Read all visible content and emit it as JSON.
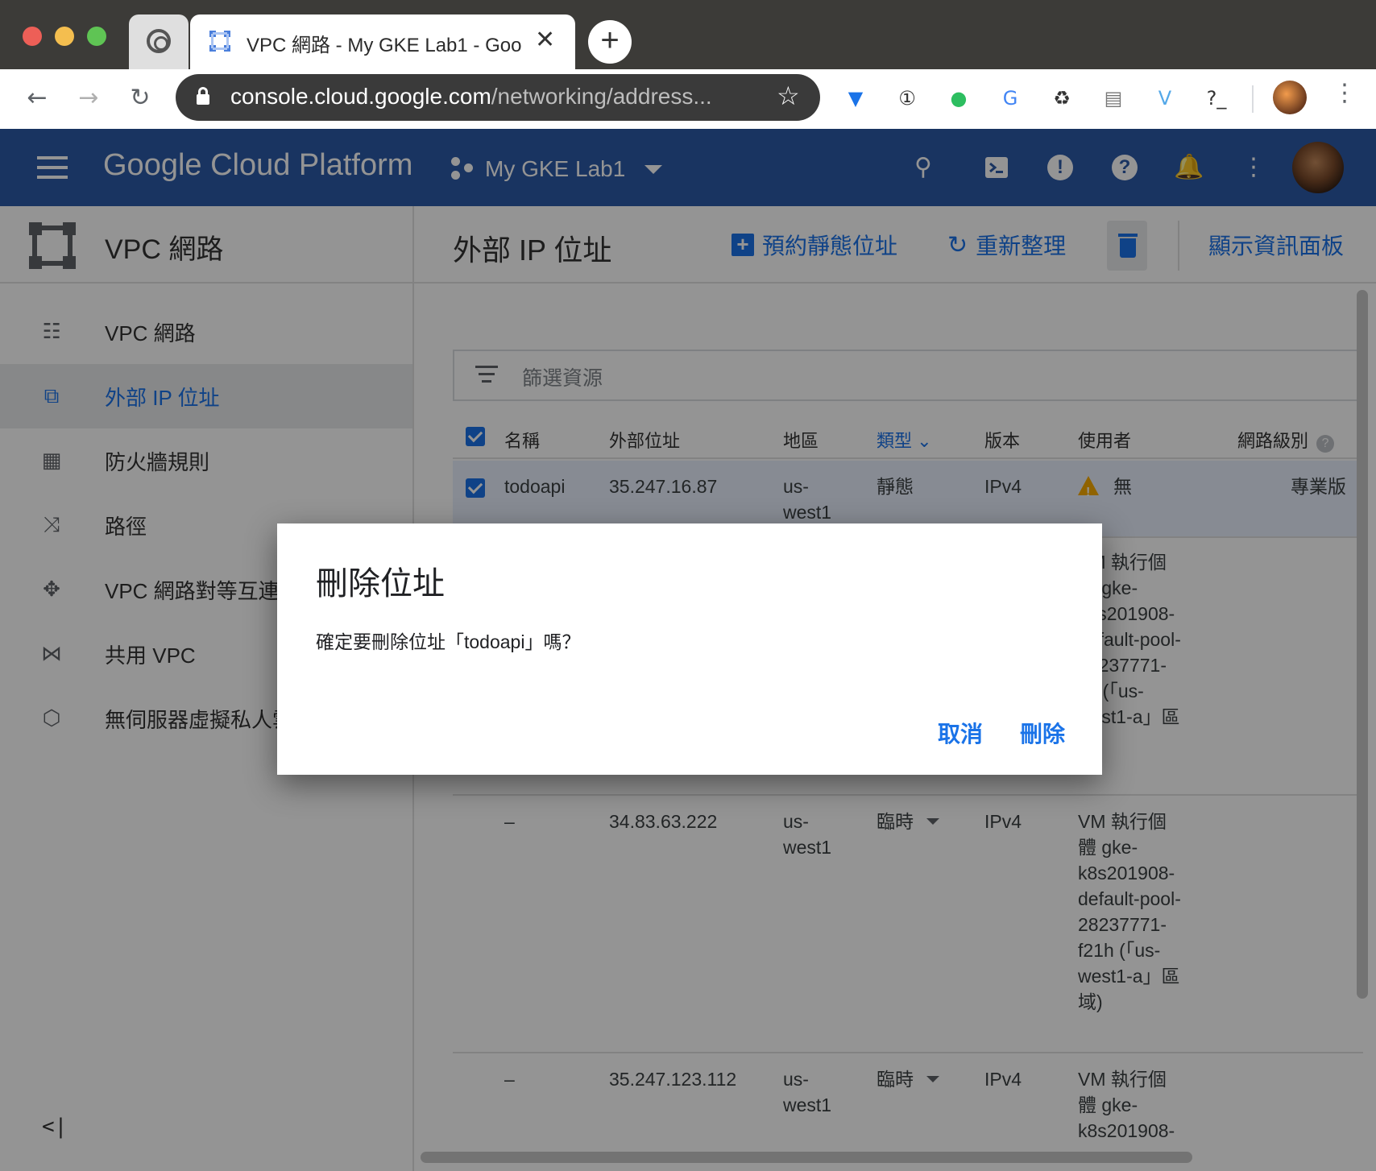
{
  "browser": {
    "tab_title": "VPC 網路 - My GKE Lab1 - Goo",
    "url_host": "console.cloud.google.com",
    "url_path": "/networking/address...",
    "new_tab": "+",
    "close": "✕",
    "extensions": [
      {
        "name": "filter-extension-icon",
        "glyph": "▼",
        "color": "#1a73e8"
      },
      {
        "name": "password-manager-icon",
        "glyph": "①",
        "color": "#333333"
      },
      {
        "name": "evernote-icon",
        "glyph": "●",
        "color": "#2dbe60"
      },
      {
        "name": "translate-icon",
        "glyph": "G",
        "color": "#4285f4"
      },
      {
        "name": "recycle-icon",
        "glyph": "♻",
        "color": "#333333"
      },
      {
        "name": "dictionary-icon",
        "glyph": "▤",
        "color": "#777777"
      },
      {
        "name": "vivaldi-icon",
        "glyph": "V",
        "color": "#54a8e8"
      },
      {
        "name": "terminal-icon",
        "glyph": "?_",
        "color": "#333333"
      }
    ]
  },
  "gcp": {
    "title": "Google Cloud Platform",
    "project": "My GKE Lab1"
  },
  "sidebar": {
    "title": "VPC 網路",
    "items": [
      {
        "label": "VPC 網路",
        "icon": "vpc-network-icon",
        "glyph": "☷",
        "active": false
      },
      {
        "label": "外部 IP 位址",
        "icon": "external-ip-icon",
        "glyph": "⧉",
        "active": true
      },
      {
        "label": "防火牆規則",
        "icon": "firewall-icon",
        "glyph": "▦",
        "active": false
      },
      {
        "label": "路徑",
        "icon": "routes-icon",
        "glyph": "⤨",
        "active": false
      },
      {
        "label": "VPC 網路對等互連",
        "icon": "peering-icon",
        "glyph": "✥",
        "active": false
      },
      {
        "label": "共用 VPC",
        "icon": "shared-vpc-icon",
        "glyph": "⋈",
        "active": false
      },
      {
        "label": "無伺服器虛擬私人雲",
        "icon": "serverless-vpc-icon",
        "glyph": "⬡",
        "active": false
      }
    ],
    "collapse": "<|"
  },
  "main": {
    "title": "外部 IP 位址",
    "actions": {
      "reserve": "預約靜態位址",
      "refresh": "重新整理",
      "show_info": "顯示資訊面板"
    },
    "filter_placeholder": "篩選資源",
    "columns": {
      "name": "名稱",
      "address": "外部位址",
      "region": "地區",
      "type": "類型",
      "version": "版本",
      "user": "使用者",
      "tier": "網路級別"
    },
    "rows": [
      {
        "name": "todoapi",
        "address": "35.247.16.87",
        "region": "us-west1",
        "type": "靜態",
        "version": "IPv4",
        "user": "無",
        "tier": "專業版"
      },
      {
        "name": "",
        "address": "",
        "region": "",
        "type": "",
        "version": "",
        "user": "VM 執行個體 gke-k8s201908-default-pool-28237771-nv (「us-west1-a」區域)",
        "tier": ""
      },
      {
        "name": "–",
        "address": "34.83.63.222",
        "region": "us-west1",
        "type": "臨時",
        "version": "IPv4",
        "user": "VM 執行個體 gke-k8s201908-default-pool-28237771-f21h (「us-west1-a」區域)",
        "tier": ""
      },
      {
        "name": "–",
        "address": "35.247.123.112",
        "region": "us-west1",
        "type": "臨時",
        "version": "IPv4",
        "user": "VM 執行個體 gke-k8s201908-",
        "tier": ""
      }
    ]
  },
  "dialog": {
    "title": "刪除位址",
    "message": "確定要刪除位址「todoapi」嗎？",
    "cancel": "取消",
    "confirm": "刪除"
  }
}
